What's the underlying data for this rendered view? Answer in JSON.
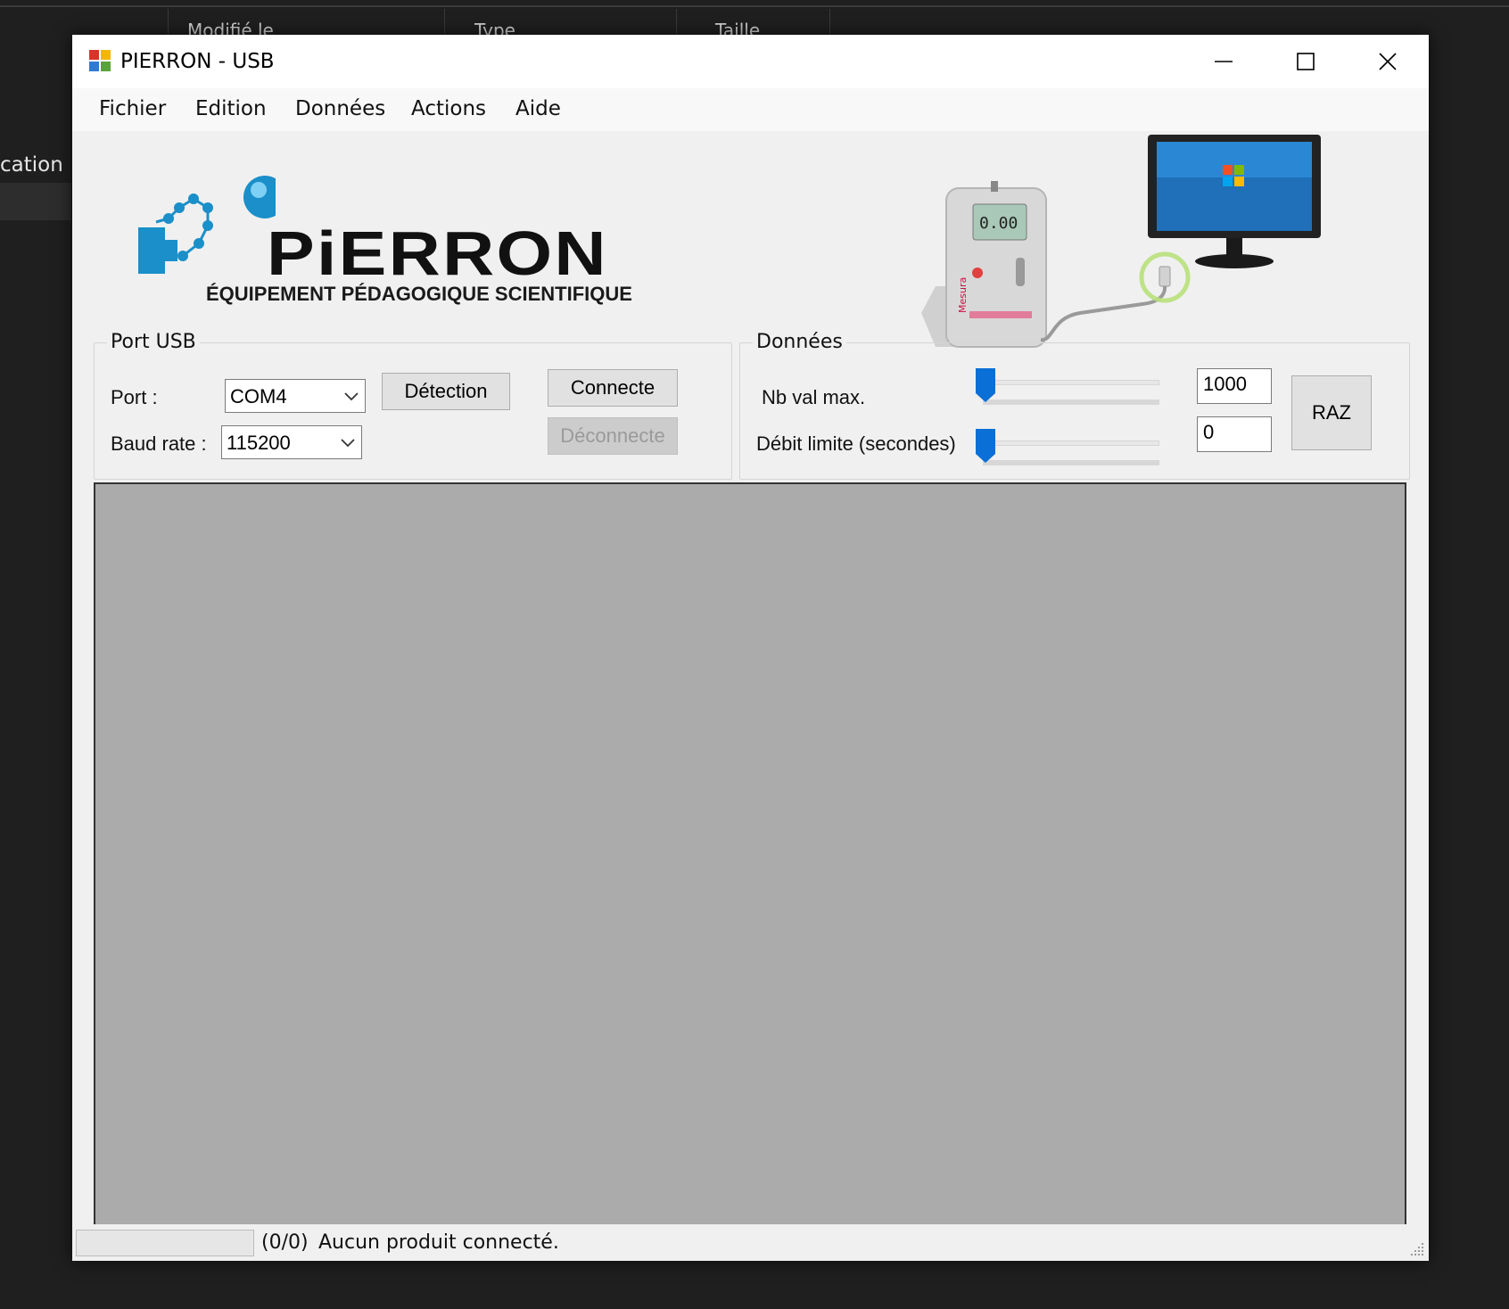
{
  "background": {
    "sidebar_fragment": "cation",
    "column_headers": [
      "Modifié le",
      "Type",
      "Taille"
    ]
  },
  "window": {
    "title": "PIERRON - USB",
    "controls": [
      "minimize",
      "maximize",
      "close"
    ]
  },
  "menu": {
    "items": [
      "Fichier",
      "Edition",
      "Données",
      "Actions",
      "Aide"
    ]
  },
  "logo": {
    "brand": "PiERRON",
    "tagline": "ÉQUIPEMENT PÉDAGOGIQUE SCIENTIFIQUE",
    "accent_color": "#1a8fc9"
  },
  "device_screen": "0.00",
  "device_brand": "Mesura",
  "usb_group": {
    "title": "Port USB",
    "port_label": "Port :",
    "port_value": "COM4",
    "baud_label": "Baud rate :",
    "baud_value": "115200",
    "detect_button": "Détection",
    "connect_button": "Connecte",
    "disconnect_button": "Déconnecte"
  },
  "data_group": {
    "title": "Données",
    "max_label": "Nb val max.",
    "max_value": "1000",
    "max_slider_level": 0,
    "rate_label": "Débit limite (secondes)",
    "rate_value": "0",
    "rate_slider_level": 0,
    "reset_button": "RAZ"
  },
  "status": {
    "progress": 0,
    "count": "(0/0)",
    "message": "Aucun produit connecté."
  },
  "colors": {
    "chart_bg": "#ababab",
    "slider_thumb": "#0a6fd6"
  }
}
